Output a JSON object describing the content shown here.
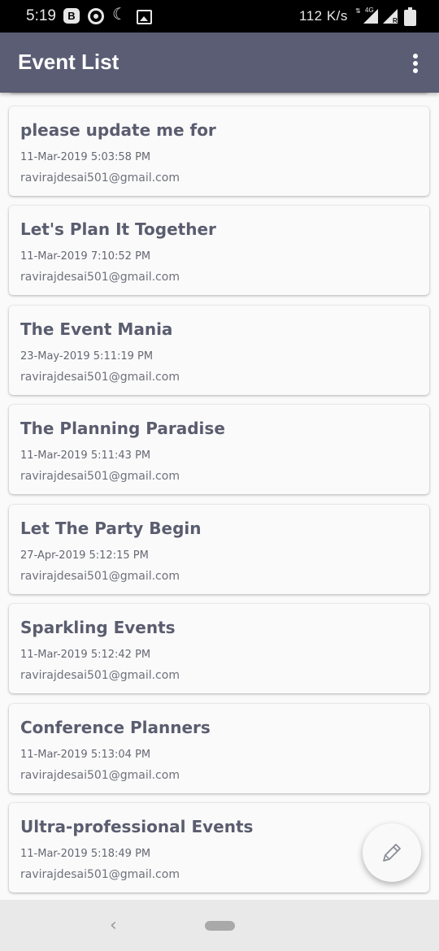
{
  "status_bar": {
    "time": "5:19",
    "notif_b_label": "B",
    "notification_icons": [
      "b-icon",
      "opera-icon",
      "moon-icon",
      "image-icon"
    ],
    "network_speed": "112 K/s",
    "signal_label": "4G",
    "signal2_label": "R",
    "status_icons": [
      "data-arrows-icon",
      "signal-icon",
      "signal-roaming-icon",
      "battery-charging-icon"
    ]
  },
  "app_bar": {
    "title": "Event List",
    "menu_icon": "more-vert-icon"
  },
  "events": [
    {
      "title": "please update me for",
      "date": "11-Mar-2019 5:03:58 PM",
      "email": "ravirajdesai501@gmail.com"
    },
    {
      "title": "Let's Plan It Together",
      "date": "11-Mar-2019 7:10:52 PM",
      "email": "ravirajdesai501@gmail.com"
    },
    {
      "title": "The Event Mania",
      "date": "23-May-2019 5:11:19 PM",
      "email": "ravirajdesai501@gmail.com"
    },
    {
      "title": "The Planning Paradise",
      "date": "11-Mar-2019 5:11:43 PM",
      "email": "ravirajdesai501@gmail.com"
    },
    {
      "title": "Let The Party Begin",
      "date": "27-Apr-2019 5:12:15 PM",
      "email": "ravirajdesai501@gmail.com"
    },
    {
      "title": "Sparkling Events",
      "date": "11-Mar-2019 5:12:42 PM",
      "email": "ravirajdesai501@gmail.com"
    },
    {
      "title": "Conference Planners",
      "date": "11-Mar-2019 5:13:04 PM",
      "email": "ravirajdesai501@gmail.com"
    },
    {
      "title": "Ultra-professional Events",
      "date": "11-Mar-2019 5:18:49 PM",
      "email": "ravirajdesai501@gmail.com"
    }
  ],
  "fab": {
    "icon": "pencil-icon"
  },
  "nav_bar": {
    "back_icon": "back-chevron-icon",
    "home_icon": "home-pill-icon"
  },
  "colors": {
    "app_bar": "#5a5d73",
    "title_text": "#5a5d6f",
    "background": "#fafafa"
  }
}
